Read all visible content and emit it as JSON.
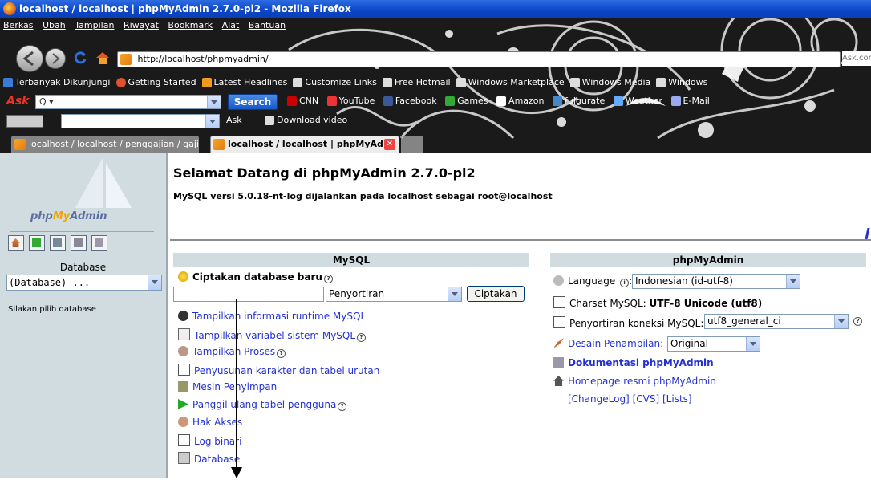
{
  "window": {
    "title": "localhost / localhost | phpMyAdmin 2.7.0-pl2 - Mozilla Firefox"
  },
  "menu": [
    "Berkas",
    "Ubah",
    "Tampilan",
    "Riwayat",
    "Bookmark",
    "Alat",
    "Bantuan"
  ],
  "address": {
    "url": "http://localhost/phpmyadmin/",
    "right_text": "Ask.cor"
  },
  "bookmarks": [
    "Terbanyak Dikunjungi",
    "Getting Started",
    "Latest Headlines",
    "Customize Links",
    "Free Hotmail",
    "Windows Marketplace",
    "Windows Media",
    "Windows"
  ],
  "asktoolbar": {
    "search_btn": "Search",
    "items": [
      "CNN",
      "YouTube",
      "Facebook",
      "Games",
      "Amazon",
      "fulgurate",
      "Weather",
      "E-Mail"
    ]
  },
  "toolbar2": {
    "ask": "Ask",
    "download": "Download video"
  },
  "tabs": [
    {
      "label": "localhost / localhost / penggajian / gaji ..."
    },
    {
      "label": "localhost / localhost | phpMyAd..."
    }
  ],
  "left": {
    "logo": {
      "php": "php",
      "my": "My",
      "admin": "Admin"
    },
    "database_label": "Database",
    "database_select": "(Database) ...",
    "hint": "Silakan pilih database"
  },
  "main": {
    "title": "Selamat Datang di phpMyAdmin 2.7.0-pl2",
    "version_line": "MySQL versi 5.0.18-nt-log dijalankan pada localhost sebagai root@localhost"
  },
  "mysql": {
    "header": "MySQL",
    "create_label": "Ciptakan database baru",
    "collation_select": "Penyortiran",
    "create_btn": "Ciptakan",
    "links": [
      {
        "text": "Tampilkan informasi runtime MySQL",
        "icon": "info-icon"
      },
      {
        "text": "Tampilkan variabel sistem MySQL",
        "icon": "variables-icon",
        "help": true
      },
      {
        "text": "Tampilkan Proses",
        "icon": "process-icon",
        "help": true
      },
      {
        "text": "Penyusunan karakter dan tabel urutan",
        "icon": "charset-icon"
      },
      {
        "text": "Mesin Penyimpan",
        "icon": "engine-icon"
      },
      {
        "text": "Panggil ulang tabel pengguna",
        "icon": "reload-icon",
        "help": true
      },
      {
        "text": "Hak Akses",
        "icon": "privileges-icon"
      },
      {
        "text": "Log binari",
        "icon": "binlog-icon"
      },
      {
        "text": "Database",
        "icon": "database-icon"
      }
    ]
  },
  "pma": {
    "header": "phpMyAdmin",
    "language_label": "Language",
    "language_select": "Indonesian (id-utf-8)",
    "charset_label": "Charset MySQL:",
    "charset_value": "UTF-8 Unicode (utf8)",
    "conn_collation_label": "Penyortiran koneksi MySQL:",
    "conn_collation_select": "utf8_general_ci",
    "theme_label": "Desain Penampilan:",
    "theme_select": "Original",
    "doc_link": "Dokumentasi phpMyAdmin",
    "home_link": "Homepage resmi phpMyAdmin",
    "extra_links": [
      "[ChangeLog]",
      "[CVS]",
      "[Lists]"
    ]
  },
  "colors": {
    "link": "#2431d0",
    "panel": "#d0dce0",
    "titlebar": "#0a46c8"
  }
}
